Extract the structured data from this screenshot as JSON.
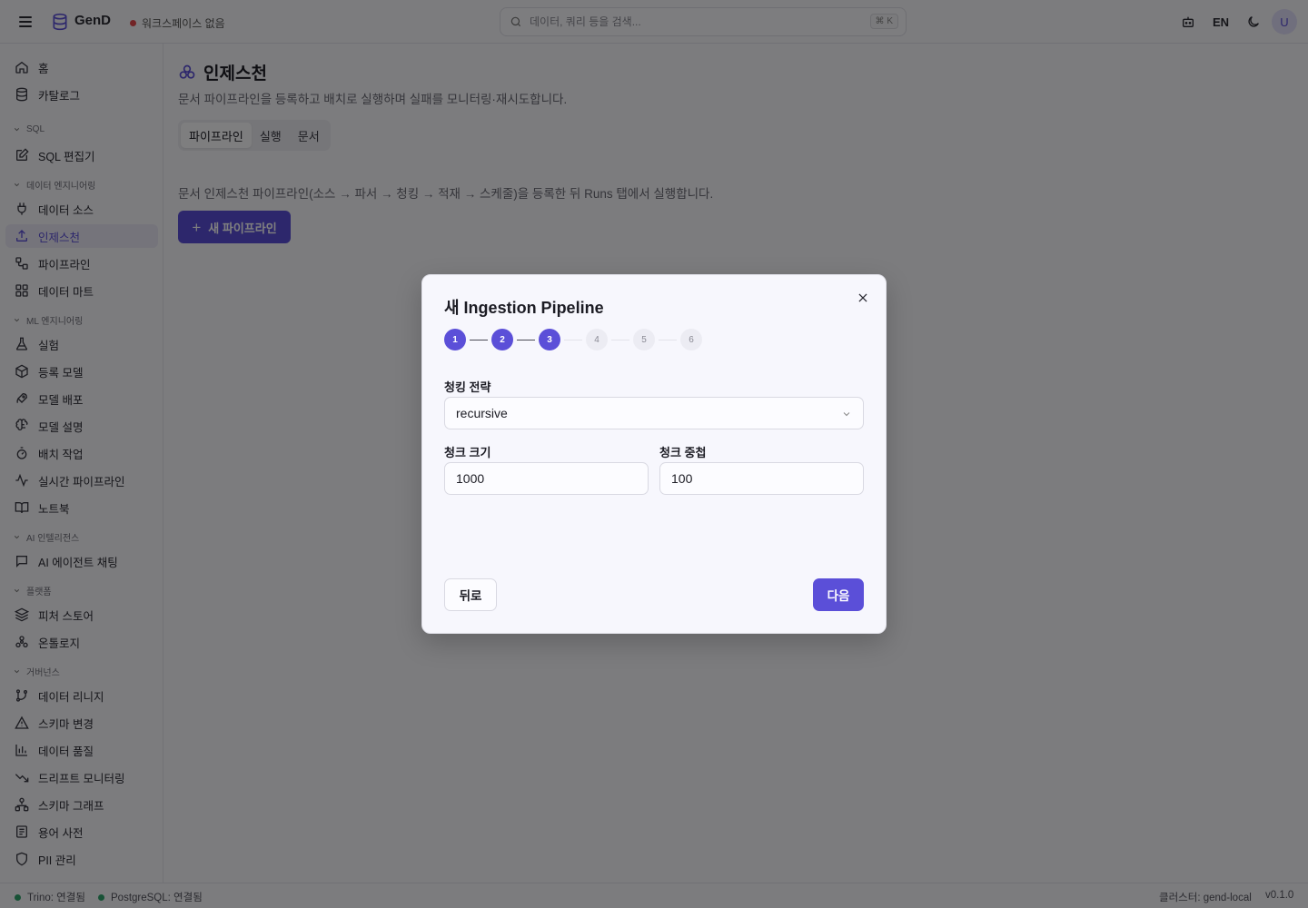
{
  "header": {
    "app_name": "GenD",
    "workspace_status": "워크스페이스 없음",
    "search_placeholder": "데이터, 쿼리 등을 검색...",
    "search_shortcut": "⌘ K",
    "language": "EN",
    "avatar_initial": "U"
  },
  "sidebar": {
    "home": "홈",
    "catalog": "카탈로그",
    "sections": {
      "sql": "SQL",
      "data_eng": "데이터 엔지니어링",
      "ml_eng": "ML 엔지니어링",
      "ai": "AI 인텔리전스",
      "platform": "플랫폼",
      "governance": "거버넌스"
    },
    "items": {
      "sql_editor": "SQL 편집기",
      "data_source": "데이터 소스",
      "ingestion": "인제스천",
      "pipeline": "파이프라인",
      "data_mart": "데이터 마트",
      "experiments": "실험",
      "registered_models": "등록 모델",
      "model_deploy": "모델 배포",
      "model_explain": "모델 설명",
      "batch_jobs": "배치 작업",
      "realtime_pipeline": "실시간 파이프라인",
      "notebook": "노트북",
      "ai_agent_chat": "AI 에이전트 채팅",
      "feature_store": "피처 스토어",
      "ontology": "온톨로지",
      "data_lineage": "데이터 리니지",
      "schema_changes": "스키마 변경",
      "data_quality": "데이터 품질",
      "drift_monitoring": "드리프트 모니터링",
      "schema_graph": "스키마 그래프",
      "glossary": "용어 사전",
      "pii": "PII 관리"
    }
  },
  "main": {
    "title": "인제스천",
    "description": "문서 파이프라인을 등록하고 배치로 실행하며 실패를 모니터링·재시도합니다.",
    "tabs": [
      "파이프라인",
      "실행",
      "문서"
    ],
    "active_tab": 0,
    "info": "문서 인제스천 파이프라인(소스 → 파서 → 청킹 → 적재 → 스케줄)을 등록한 뒤 Runs 탭에서 실행합니다.",
    "new_pipeline_button": "새 파이프라인"
  },
  "modal": {
    "title": "새 Ingestion Pipeline",
    "steps": [
      "1",
      "2",
      "3",
      "4",
      "5",
      "6"
    ],
    "current_step": 3,
    "chunking_strategy_label": "청킹 전략",
    "chunking_strategy_value": "recursive",
    "chunk_size_label": "청크 크기",
    "chunk_size_value": "1000",
    "chunk_overlap_label": "청크 중첩",
    "chunk_overlap_value": "100",
    "back_button": "뒤로",
    "next_button": "다음"
  },
  "footer": {
    "trino_status": "Trino: 연결됨",
    "postgres_status": "PostgreSQL: 연결됨",
    "cluster": "클러스터: gend-local",
    "version": "v0.1.0"
  },
  "colors": {
    "accent": "#5b4fd8",
    "status_ok": "#30a46c",
    "status_error": "#e5484d"
  }
}
